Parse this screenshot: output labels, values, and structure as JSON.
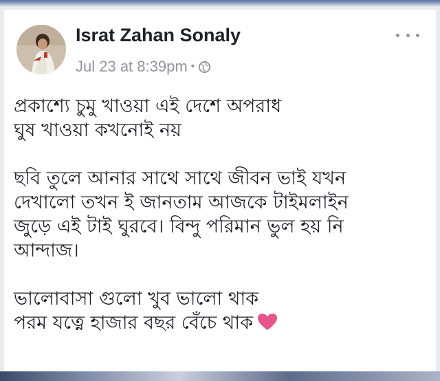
{
  "post": {
    "author": "Israt Zahan Sonaly",
    "timestamp": "Jul 23 at 8:39pm",
    "privacy_separator": "•",
    "privacy_icon": "globe-icon",
    "more_icon": "more-options-icon",
    "paragraphs": [
      {
        "lines": [
          "প্রকাশ্যে চুমু খাওয়া এই দেশে অপরাধ",
          "ঘুষ খাওয়া কখনোই নয়"
        ]
      },
      {
        "lines": [
          "ছবি তুলে আনার সাথে সাথে জীবন ভাই যখন",
          "দেখালো তখন ই জানতাম আজকে টাইমলাইন",
          "জুড়ে এই টাই ঘুরবে। বিন্দু পরিমান ভুল হয় নি",
          "আন্দাজ।"
        ]
      },
      {
        "lines": [
          "ভালোবাসা গুলো খুব ভালো থাক",
          "পরম যত্নে হাজার বছর বেঁচে থাক"
        ]
      }
    ],
    "trailing_emoji": "pink-heart-icon"
  },
  "colors": {
    "name": "#1d2129",
    "meta": "#90949c",
    "heart": "#e8548c",
    "background": "#e9ebee"
  }
}
